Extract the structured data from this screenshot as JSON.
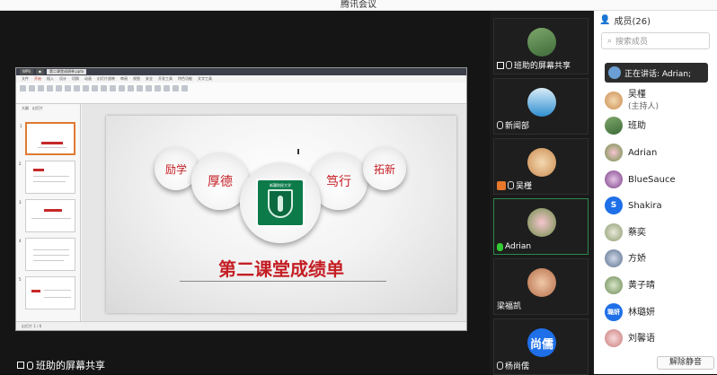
{
  "window": {
    "title": "腾讯会议"
  },
  "share": {
    "label": "班助的屏幕共享"
  },
  "wps": {
    "tabs": [
      "",
      "",
      ""
    ],
    "menu": [
      "文件",
      "开始",
      "插入",
      "设计",
      "切换",
      "动画",
      "幻灯片放映",
      "审阅",
      "视图",
      "安全",
      "开发工具",
      "特色功能",
      "文字工具"
    ],
    "panel_tabs": [
      "大纲",
      "幻灯片"
    ],
    "status": "幻灯片 1 / 6"
  },
  "slide": {
    "bubbles": [
      "励学",
      "厚德",
      "笃行",
      "拓新"
    ],
    "logo_text": "新疆财经大学",
    "title": "第二课堂成绩单"
  },
  "strip": {
    "tiles": [
      {
        "name": "班助的屏幕共享"
      },
      {
        "name": "新闻部"
      },
      {
        "name": "吴槿"
      },
      {
        "name": "Adrian"
      },
      {
        "name": "梁福凯"
      },
      {
        "name": "杨尚儒",
        "avatar_text": "尚儒"
      }
    ]
  },
  "panel": {
    "header": "成员(26)",
    "search_placeholder": "搜索成员",
    "speaking": "正在讲话: Adrian;",
    "members": [
      {
        "name": "吴槿",
        "sub": "(主持人)"
      },
      {
        "name": "班助"
      },
      {
        "name": "Adrian"
      },
      {
        "name": "BlueSauce"
      },
      {
        "name": "Shakira",
        "avatar_text": "S"
      },
      {
        "name": "蔡奕"
      },
      {
        "name": "方娇"
      },
      {
        "name": "黄子晴"
      },
      {
        "name": "林璐妍",
        "avatar_text": "璐妍"
      },
      {
        "name": "刘馨语"
      }
    ],
    "unmute": "解除静音"
  },
  "colors": {
    "accent_red": "#c41e24",
    "brand_blue": "#1e6fe8",
    "speaking_green": "#2b8a4d"
  }
}
